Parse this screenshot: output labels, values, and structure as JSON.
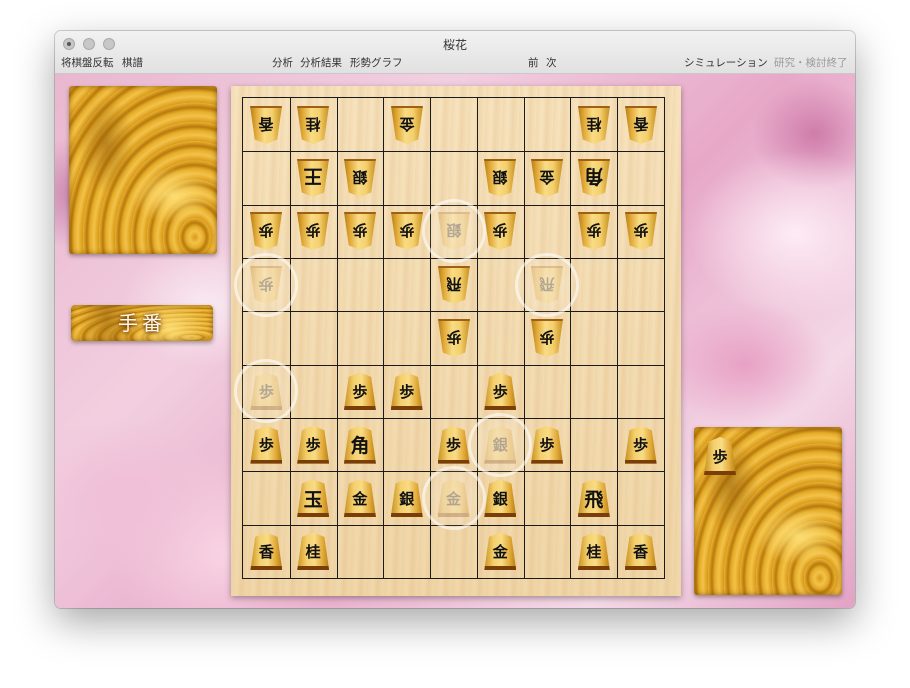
{
  "window": {
    "title": "桜花"
  },
  "menu": {
    "flip": "将棋盤反転",
    "kifu": "棋譜",
    "analysis": "分析",
    "analysis_result": "分析結果",
    "graph": "形勢グラフ",
    "prev": "前",
    "next": "次",
    "simulation": "シミュレーション",
    "study_end": "研究・検討終了"
  },
  "turn_label": "手番",
  "colors": {
    "accent_wood": "#e4ac28",
    "board": "#f3dcb1",
    "grid": "#1a1a1a",
    "bg_blossom": "#e9b7cf"
  },
  "board": {
    "pieces": [
      {
        "t": "香",
        "owner": "gote",
        "col": 0,
        "row": 0
      },
      {
        "t": "桂",
        "owner": "gote",
        "col": 1,
        "row": 0
      },
      {
        "t": "金",
        "owner": "gote",
        "col": 3,
        "row": 0
      },
      {
        "t": "桂",
        "owner": "gote",
        "col": 7,
        "row": 0
      },
      {
        "t": "香",
        "owner": "gote",
        "col": 8,
        "row": 0
      },
      {
        "t": "王",
        "owner": "gote",
        "col": 1,
        "row": 1,
        "big": true
      },
      {
        "t": "銀",
        "owner": "gote",
        "col": 2,
        "row": 1
      },
      {
        "t": "銀",
        "owner": "gote",
        "col": 5,
        "row": 1
      },
      {
        "t": "金",
        "owner": "gote",
        "col": 6,
        "row": 1
      },
      {
        "t": "角",
        "owner": "gote",
        "col": 7,
        "row": 1,
        "big": true
      },
      {
        "t": "歩",
        "owner": "gote",
        "col": 0,
        "row": 2
      },
      {
        "t": "歩",
        "owner": "gote",
        "col": 1,
        "row": 2
      },
      {
        "t": "歩",
        "owner": "gote",
        "col": 2,
        "row": 2
      },
      {
        "t": "歩",
        "owner": "gote",
        "col": 3,
        "row": 2
      },
      {
        "t": "銀",
        "owner": "gote",
        "col": 4,
        "row": 2,
        "ghost": true
      },
      {
        "t": "歩",
        "owner": "gote",
        "col": 5,
        "row": 2
      },
      {
        "t": "歩",
        "owner": "gote",
        "col": 7,
        "row": 2
      },
      {
        "t": "歩",
        "owner": "gote",
        "col": 8,
        "row": 2
      },
      {
        "t": "歩",
        "owner": "gote",
        "col": 0,
        "row": 3,
        "ghost": true
      },
      {
        "t": "飛",
        "owner": "gote",
        "col": 4,
        "row": 3
      },
      {
        "t": "飛",
        "owner": "gote",
        "col": 6,
        "row": 3,
        "ghost": true
      },
      {
        "t": "歩",
        "owner": "gote",
        "col": 4,
        "row": 4
      },
      {
        "t": "歩",
        "owner": "gote",
        "col": 6,
        "row": 4
      },
      {
        "t": "歩",
        "owner": "sente",
        "col": 0,
        "row": 5,
        "ghost": true
      },
      {
        "t": "歩",
        "owner": "sente",
        "col": 2,
        "row": 5
      },
      {
        "t": "歩",
        "owner": "sente",
        "col": 3,
        "row": 5
      },
      {
        "t": "歩",
        "owner": "sente",
        "col": 5,
        "row": 5
      },
      {
        "t": "歩",
        "owner": "sente",
        "col": 0,
        "row": 6
      },
      {
        "t": "歩",
        "owner": "sente",
        "col": 1,
        "row": 6
      },
      {
        "t": "角",
        "owner": "sente",
        "col": 2,
        "row": 6,
        "big": true
      },
      {
        "t": "歩",
        "owner": "sente",
        "col": 4,
        "row": 6
      },
      {
        "t": "銀",
        "owner": "sente",
        "col": 5,
        "row": 6,
        "ghost": true
      },
      {
        "t": "歩",
        "owner": "sente",
        "col": 6,
        "row": 6
      },
      {
        "t": "歩",
        "owner": "sente",
        "col": 8,
        "row": 6
      },
      {
        "t": "玉",
        "owner": "sente",
        "col": 1,
        "row": 7,
        "big": true
      },
      {
        "t": "金",
        "owner": "sente",
        "col": 2,
        "row": 7
      },
      {
        "t": "銀",
        "owner": "sente",
        "col": 3,
        "row": 7
      },
      {
        "t": "金",
        "owner": "sente",
        "col": 4,
        "row": 7,
        "ghost": true
      },
      {
        "t": "銀",
        "owner": "sente",
        "col": 5,
        "row": 7
      },
      {
        "t": "飛",
        "owner": "sente",
        "col": 7,
        "row": 7,
        "big": true
      },
      {
        "t": "香",
        "owner": "sente",
        "col": 0,
        "row": 8
      },
      {
        "t": "桂",
        "owner": "sente",
        "col": 1,
        "row": 8
      },
      {
        "t": "金",
        "owner": "sente",
        "col": 5,
        "row": 8
      },
      {
        "t": "桂",
        "owner": "sente",
        "col": 7,
        "row": 8
      },
      {
        "t": "香",
        "owner": "sente",
        "col": 8,
        "row": 8
      }
    ],
    "highlights": [
      {
        "col": 4,
        "row": 2
      },
      {
        "col": 0,
        "row": 3
      },
      {
        "col": 6,
        "row": 3
      },
      {
        "col": 0,
        "row": 5
      },
      {
        "col": 5,
        "row": 6
      },
      {
        "col": 4,
        "row": 7
      }
    ]
  },
  "hand": {
    "gote": [],
    "sente": [
      {
        "t": "歩"
      }
    ]
  }
}
